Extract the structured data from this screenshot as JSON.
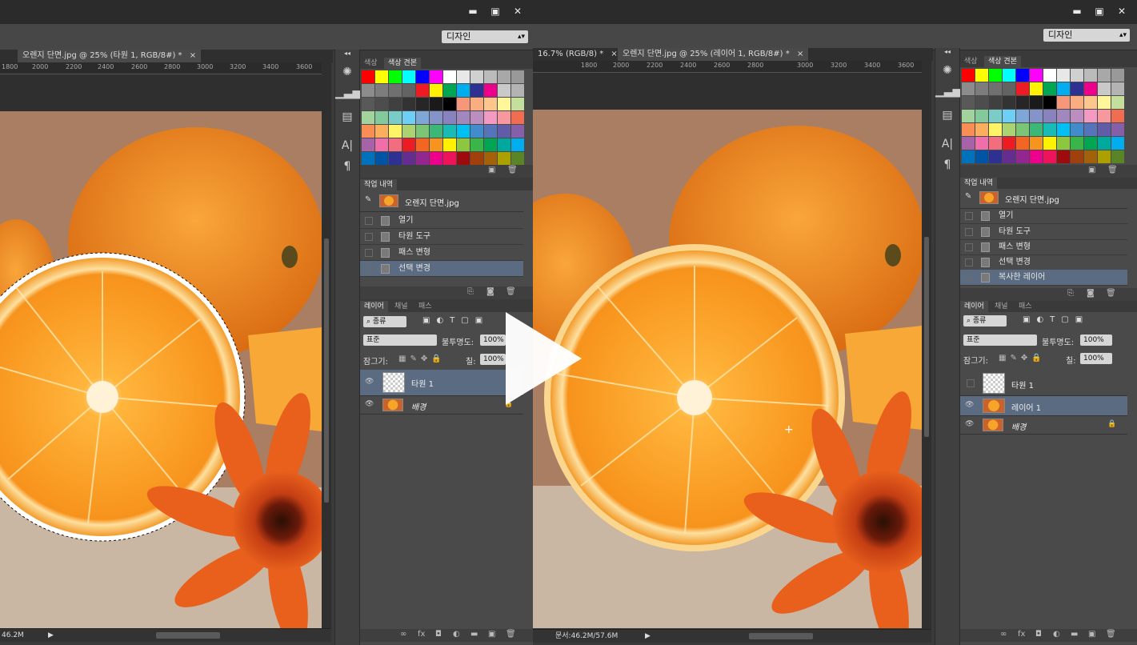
{
  "left": {
    "workspace": "디자인",
    "doc_tab": "오렌지 단면.jpg @ 25% (타원 1, RGB/8#) *",
    "doc_tab_close": "×",
    "ruler_ticks": [
      "1800",
      "2000",
      "2200",
      "2400",
      "2600",
      "2800",
      "3000",
      "3200",
      "3400",
      "3600"
    ],
    "status_size": "46.2M",
    "panels": {
      "color_tab": "색상",
      "swatches_tab": "색상 견본",
      "history_tab": "작업 내역",
      "history_source": "오렌지 단면.jpg",
      "history_items": [
        "열기",
        "타원 도구",
        "패스 변형",
        "선택 변경"
      ],
      "layers_tab": "레이어",
      "channels_tab": "채널",
      "paths_tab": "패스",
      "kind_label": "종류",
      "blend_mode": "표준",
      "opacity_label": "불투명도:",
      "opacity_value": "100%",
      "lock_label": "잠그기:",
      "fill_label": "칠:",
      "fill_value": "100%",
      "layers": [
        "타원 1",
        "배경"
      ]
    }
  },
  "right": {
    "workspace": "디자인",
    "doc_tab_prev": "16.7% (RGB/8) *",
    "doc_tab": "오렌지 단면.jpg @ 25% (레이어 1, RGB/8#) *",
    "doc_tab_close": "×",
    "ruler_ticks": [
      "1800",
      "2000",
      "2200",
      "2400",
      "2600",
      "2800",
      "3000",
      "3200",
      "3400",
      "3600"
    ],
    "status_doc": "문서:46.2M/57.6M",
    "panels": {
      "color_tab": "색상",
      "swatches_tab": "색상 견본",
      "history_tab": "작업 내역",
      "history_source": "오렌지 단면.jpg",
      "history_items": [
        "열기",
        "타원 도구",
        "패스 변형",
        "선택 변경",
        "복사한 레이어"
      ],
      "layers_tab": "레이어",
      "channels_tab": "채널",
      "paths_tab": "패스",
      "kind_label": "종류",
      "blend_mode": "표준",
      "opacity_label": "불투명도:",
      "opacity_value": "100%",
      "lock_label": "잠그기:",
      "fill_label": "칠:",
      "fill_value": "100%",
      "layers": [
        "타원 1",
        "레이어 1",
        "배경"
      ]
    }
  },
  "window_buttons": {
    "minimize": "▬",
    "restore": "▣",
    "close": "✕"
  },
  "swatch_colors": [
    "#ff0000",
    "#ffff00",
    "#00ff00",
    "#00ffff",
    "#0000ff",
    "#ff00ff",
    "#ffffff",
    "#e8e8e8",
    "#d0d0d0",
    "#bbbbbb",
    "#a8a8a8",
    "#999999",
    "#8c8c8c",
    "#7d7d7d",
    "#707070",
    "#636363",
    "#ed1c24",
    "#fff200",
    "#00a651",
    "#00aeef",
    "#2e3192",
    "#ec008c",
    "#c9c9c9",
    "#b3b3b3",
    "#595959",
    "#4d4d4d",
    "#404040",
    "#333333",
    "#262626",
    "#1a1a1a",
    "#000000",
    "#f7977a",
    "#fbad82",
    "#fdc68c",
    "#fff79a",
    "#c4df9b",
    "#a2d39c",
    "#82ca9c",
    "#7accc8",
    "#6dcff6",
    "#7ea7d8",
    "#8493ca",
    "#8882be",
    "#a187be",
    "#bc8dbf",
    "#f49ac2",
    "#f6989d",
    "#f26c4f",
    "#f68e55",
    "#fbaf5c",
    "#fff467",
    "#acd372",
    "#7cc576",
    "#3bb878",
    "#1abbb4",
    "#00bff3",
    "#438ccb",
    "#5574b9",
    "#605ca8",
    "#855fa8",
    "#a763a8",
    "#f06ea9",
    "#f26d7d",
    "#ed1c24",
    "#f26522",
    "#f7941d",
    "#fff200",
    "#8dc73f",
    "#39b54a",
    "#00a651",
    "#00a99d",
    "#00aeef",
    "#0072bc",
    "#0054a6",
    "#2e3192",
    "#662d91",
    "#92278f",
    "#ec008c",
    "#ed145b",
    "#9e0b0f",
    "#a0410d",
    "#a36209",
    "#aba000",
    "#598527"
  ],
  "accent": "#5a6b82"
}
